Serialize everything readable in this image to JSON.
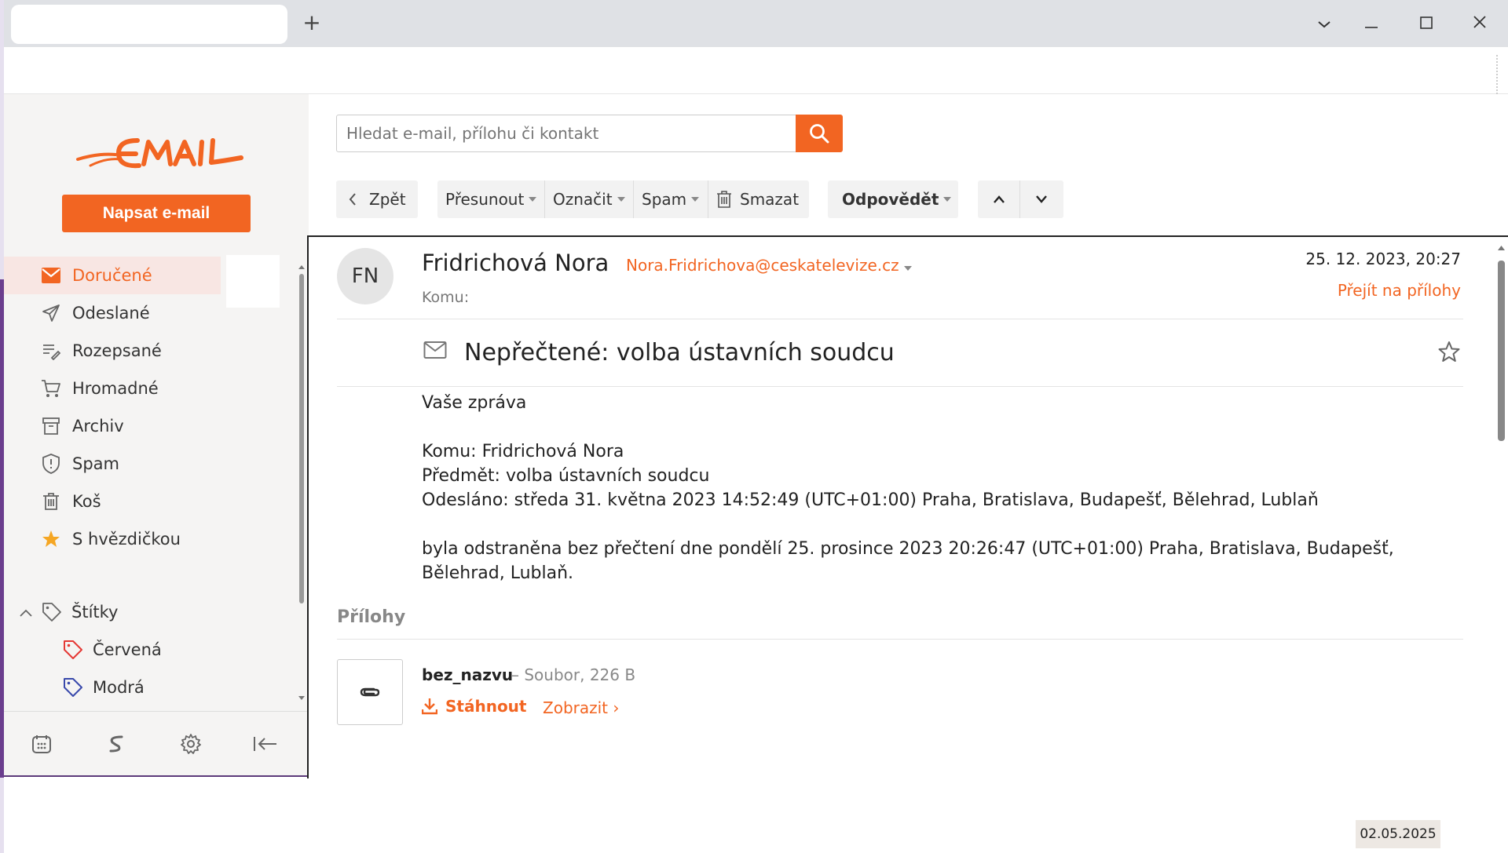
{
  "browser": {
    "new_tab_label": "+",
    "window_controls": {
      "dropdown": "⌄",
      "minimize": "—",
      "maximize": "☐",
      "close": "✕"
    }
  },
  "app": {
    "logo_text": "EMAIL",
    "compose_label": "Napsat e-mail",
    "accent_color": "#f26522"
  },
  "sidebar": {
    "items": [
      {
        "label": "Doručené",
        "icon": "inbox-icon",
        "active": true
      },
      {
        "label": "Odeslané",
        "icon": "send-icon"
      },
      {
        "label": "Rozepsané",
        "icon": "draft-icon"
      },
      {
        "label": "Hromadné",
        "icon": "cart-icon"
      },
      {
        "label": "Archiv",
        "icon": "archive-icon"
      },
      {
        "label": "Spam",
        "icon": "shield-icon"
      },
      {
        "label": "Koš",
        "icon": "trash-icon"
      },
      {
        "label": "S hvězdičkou",
        "icon": "star-icon"
      }
    ],
    "labels_header": "Štítky",
    "labels": [
      {
        "label": "Červená",
        "color": "#e53935"
      },
      {
        "label": "Modrá",
        "color": "#3949ab"
      }
    ],
    "bottom_icons": [
      "calendar-icon",
      "s-brand-icon",
      "settings-icon",
      "collapse-icon"
    ]
  },
  "search": {
    "placeholder": "Hledat e-mail, přílohu či kontakt"
  },
  "toolbar": {
    "back": "Zpět",
    "move": "Přesunout",
    "mark": "Označit",
    "spam": "Spam",
    "delete": "Smazat",
    "reply": "Odpovědět"
  },
  "message": {
    "avatar_initials": "FN",
    "sender_name": "Fridrichová Nora",
    "sender_email": "Nora.Fridrichova@ceskatelevize.cz",
    "to_label": "Komu:",
    "date": "25. 12. 2023, 20:27",
    "goto_attachments": "Přejít na přílohy",
    "subject": "Nepřečtené: volba ústavních soudcu",
    "body": {
      "line1": "Vaše zpráva",
      "line2": "Komu: Fridrichová Nora",
      "line3": "Předmět: volba ústavních soudcu",
      "line4": "Odesláno: středa 31. května 2023 14:52:49 (UTC+01:00) Praha, Bratislava, Budapešť, Bělehrad, Lublaň",
      "line5": "byla odstraněna bez přečtení dne pondělí 25. prosince 2023 20:26:47 (UTC+01:00) Praha, Bratislava, Budapešť, Bělehrad, Lublaň."
    },
    "attachments_header": "Přílohy",
    "attachment": {
      "name": "bez_nazvu",
      "meta": "– Soubor, 226 B",
      "download": "Stáhnout",
      "view": "Zobrazit ›"
    }
  },
  "taskbar": {
    "date": "02.05.2025"
  }
}
